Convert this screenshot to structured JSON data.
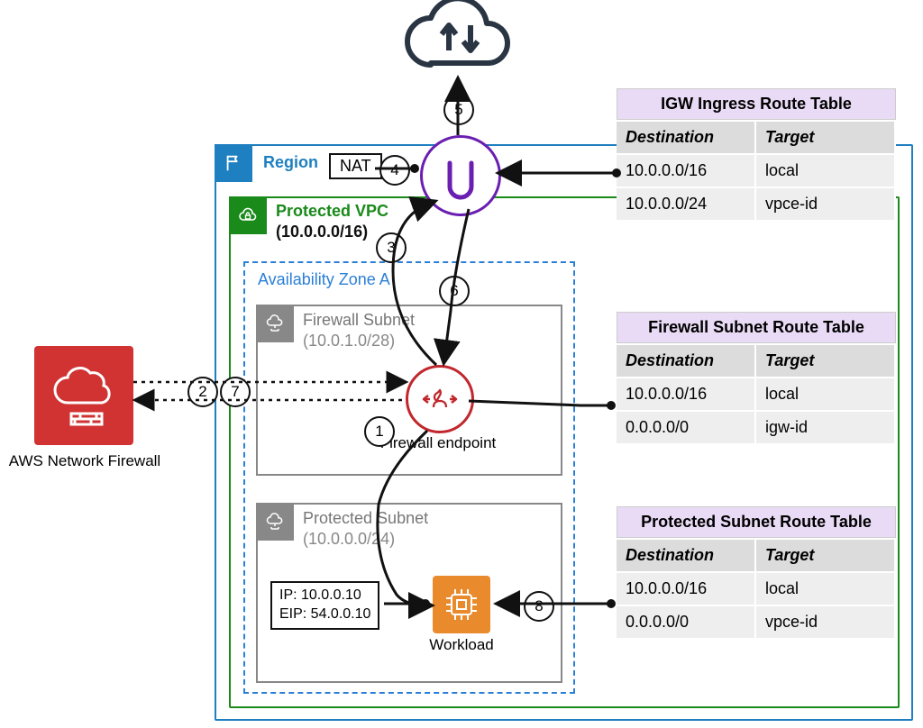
{
  "region": {
    "label": "Region"
  },
  "vpc": {
    "label": "Protected VPC",
    "cidr": "(10.0.0.0/16)"
  },
  "az": {
    "label": "Availability Zone A"
  },
  "fw_subnet": {
    "name": "Firewall Subnet",
    "cidr": "(10.0.1.0/28)",
    "endpoint_label": "Firewall endpoint"
  },
  "prot_subnet": {
    "name": "Protected Subnet",
    "cidr": "(10.0.0.0/24)",
    "workload_label": "Workload",
    "ip_line": "IP: 10.0.0.10",
    "eip_line": "EIP: 54.0.0.10"
  },
  "nat_label": "NAT",
  "nfw_label": "AWS Network Firewall",
  "steps": {
    "s1": "1",
    "s2": "2",
    "s3": "3",
    "s4": "4",
    "s5": "5",
    "s6": "6",
    "s7": "7",
    "s8": "8"
  },
  "rt_headers": {
    "dest": "Destination",
    "target": "Target"
  },
  "rt_igw": {
    "title": "IGW Ingress Route Table",
    "r1": {
      "dest": "10.0.0.0/16",
      "target": "local"
    },
    "r2": {
      "dest": "10.0.0.0/24",
      "target": "vpce-id"
    }
  },
  "rt_fw": {
    "title": "Firewall Subnet Route Table",
    "r1": {
      "dest": "10.0.0.0/16",
      "target": "local"
    },
    "r2": {
      "dest": "0.0.0.0/0",
      "target": "igw-id"
    }
  },
  "rt_prot": {
    "title": "Protected Subnet Route Table",
    "r1": {
      "dest": "10.0.0.0/16",
      "target": "local"
    },
    "r2": {
      "dest": "0.0.0.0/0",
      "target": "vpce-id"
    }
  }
}
